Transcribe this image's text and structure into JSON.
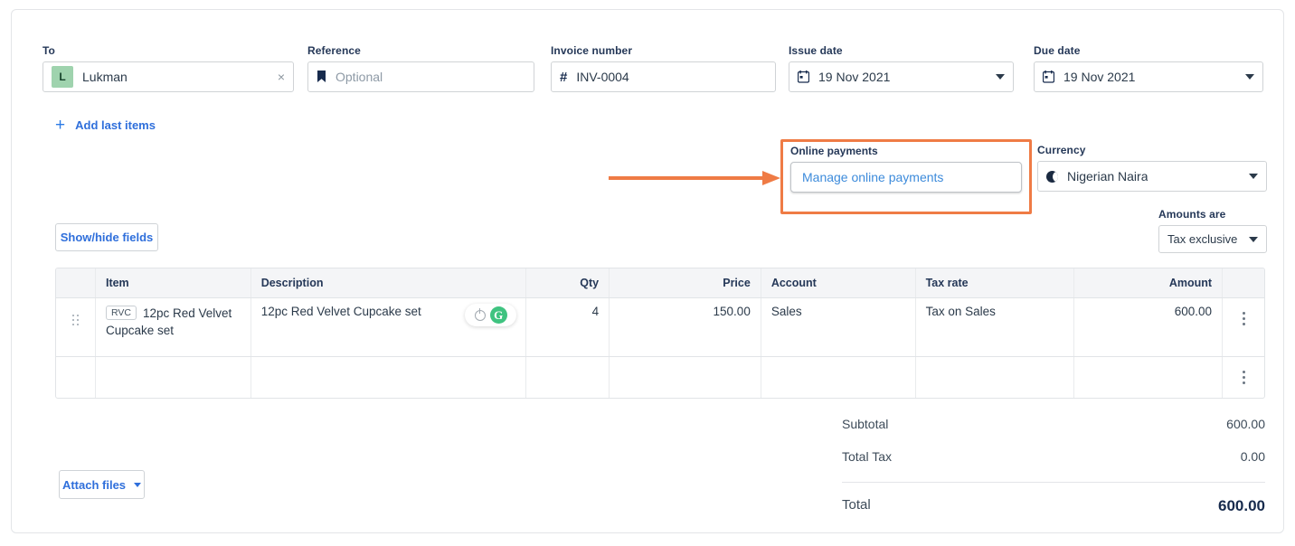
{
  "header": {
    "to": {
      "label": "To",
      "avatar_initial": "L",
      "value": "Lukman",
      "clear": "×"
    },
    "reference": {
      "label": "Reference",
      "placeholder": "Optional",
      "value": ""
    },
    "invoice_number": {
      "label": "Invoice number",
      "prefix": "#",
      "value": "INV-0004"
    },
    "issue_date": {
      "label": "Issue date",
      "value": "19 Nov 2021"
    },
    "due_date": {
      "label": "Due date",
      "value": "19 Nov 2021"
    }
  },
  "actions": {
    "add_last_items": "Add last items",
    "plus": "+",
    "show_hide_fields": "Show/hide fields",
    "attach_files": "Attach files"
  },
  "online_payments": {
    "label": "Online payments",
    "button_label": "Manage online payments",
    "highlight_color": "#ef7b45"
  },
  "currency": {
    "label": "Currency",
    "value": "Nigerian Naira"
  },
  "amounts_are": {
    "label": "Amounts are",
    "value": "Tax exclusive"
  },
  "table": {
    "columns": [
      "",
      "Item",
      "Description",
      "Qty",
      "Price",
      "Account",
      "Tax rate",
      "Amount",
      ""
    ],
    "rows": [
      {
        "sku": "RVC",
        "item": "12pc Red Velvet Cupcake set",
        "description": "12pc Red Velvet Cupcake set",
        "qty": "4",
        "price": "150.00",
        "account": "Sales",
        "tax_rate": "Tax on Sales",
        "amount": "600.00"
      },
      {
        "sku": "",
        "item": "",
        "description": "",
        "qty": "",
        "price": "",
        "account": "",
        "tax_rate": "",
        "amount": ""
      }
    ]
  },
  "totals": {
    "subtotal_label": "Subtotal",
    "subtotal_value": "600.00",
    "tax_label": "Total Tax",
    "tax_value": "0.00",
    "total_label": "Total",
    "total_value": "600.00"
  }
}
